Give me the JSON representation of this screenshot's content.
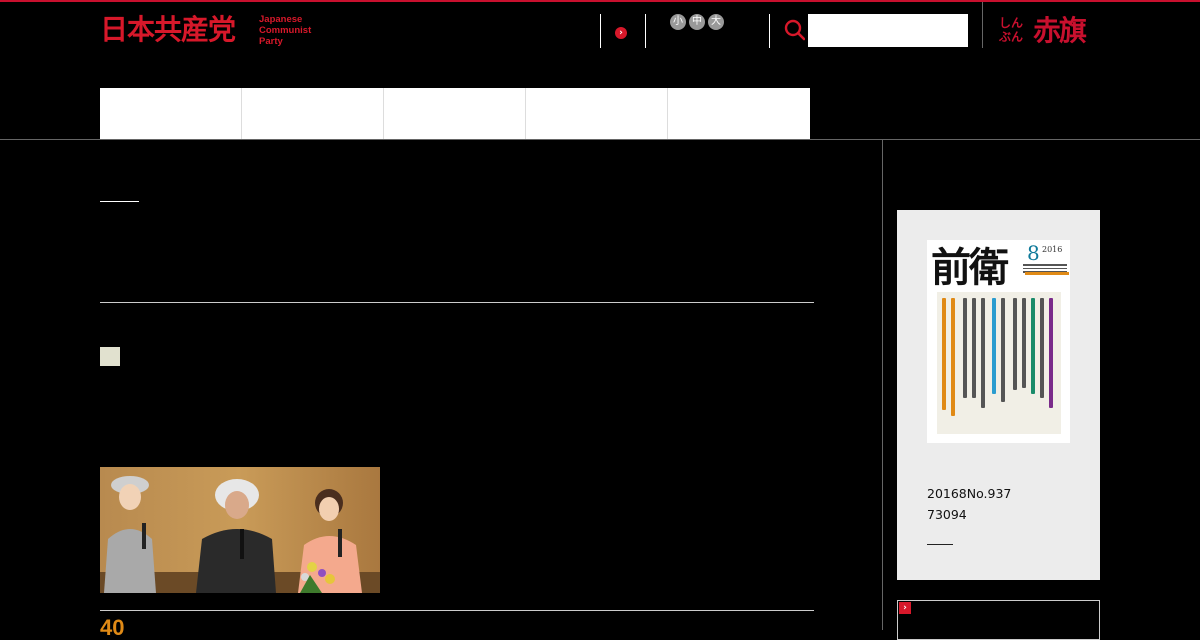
{
  "header": {
    "logo_jp": "日本共産党",
    "logo_en": [
      "Japanese",
      "Communist",
      "Party"
    ],
    "arrow_glyph": "›",
    "font_sizes": [
      "小",
      "中",
      "大"
    ],
    "search_placeholder": "",
    "search_icon": "search-icon",
    "akahata_small": [
      "しん",
      "ぶん"
    ],
    "akahata_big": "赤旗"
  },
  "nav": {
    "items": [
      "",
      "",
      "",
      "",
      ""
    ]
  },
  "main": {
    "date_partial": "40"
  },
  "sidebar": {
    "magazine": {
      "title": "前衛",
      "issue_month": "8",
      "issue_year": "2016",
      "issue_line": "20168No.937",
      "price_line": "73094"
    },
    "box2_glyph": "›"
  },
  "colors": {
    "brand_red": "#d7182a",
    "accent_orange": "#e08a16",
    "background": "#000000"
  }
}
